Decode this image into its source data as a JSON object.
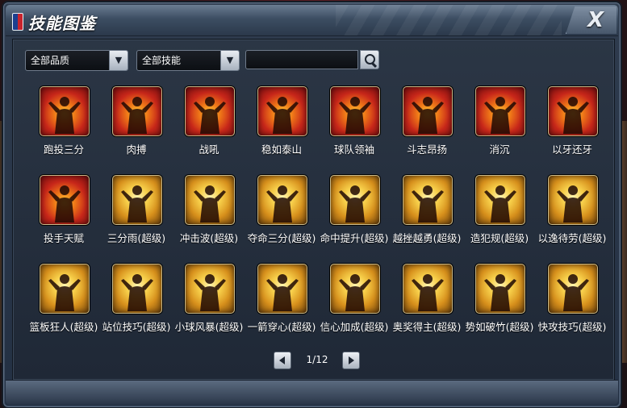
{
  "window": {
    "title": "技能图鉴",
    "close_label": "X"
  },
  "filters": {
    "quality": {
      "value": "全部品质"
    },
    "skill_type": {
      "value": "全部技能"
    },
    "search": {
      "value": "",
      "placeholder": ""
    }
  },
  "skills": [
    {
      "label": "跑投三分",
      "tier": "red"
    },
    {
      "label": "肉搏",
      "tier": "red"
    },
    {
      "label": "战吼",
      "tier": "red"
    },
    {
      "label": "稳如泰山",
      "tier": "red"
    },
    {
      "label": "球队领袖",
      "tier": "red"
    },
    {
      "label": "斗志昂扬",
      "tier": "red"
    },
    {
      "label": "消沉",
      "tier": "red"
    },
    {
      "label": "以牙还牙",
      "tier": "red"
    },
    {
      "label": "投手天赋",
      "tier": "red"
    },
    {
      "label": "三分雨(超级)",
      "tier": "gold"
    },
    {
      "label": "冲击波(超级)",
      "tier": "gold"
    },
    {
      "label": "夺命三分(超级)",
      "tier": "gold"
    },
    {
      "label": "命中提升(超级)",
      "tier": "gold"
    },
    {
      "label": "越挫越勇(超级)",
      "tier": "gold"
    },
    {
      "label": "造犯规(超级)",
      "tier": "gold"
    },
    {
      "label": "以逸待劳(超级)",
      "tier": "gold"
    },
    {
      "label": "篮板狂人(超级)",
      "tier": "gold"
    },
    {
      "label": "站位技巧(超级)",
      "tier": "gold"
    },
    {
      "label": "小球风暴(超级)",
      "tier": "gold"
    },
    {
      "label": "一箭穿心(超级)",
      "tier": "gold"
    },
    {
      "label": "信心加成(超级)",
      "tier": "gold"
    },
    {
      "label": "奥奖得主(超级)",
      "tier": "gold"
    },
    {
      "label": "势如破竹(超级)",
      "tier": "gold"
    },
    {
      "label": "快攻技巧(超级)",
      "tier": "gold"
    }
  ],
  "pagination": {
    "indicator": "1/12",
    "current": 1,
    "total": 12
  }
}
